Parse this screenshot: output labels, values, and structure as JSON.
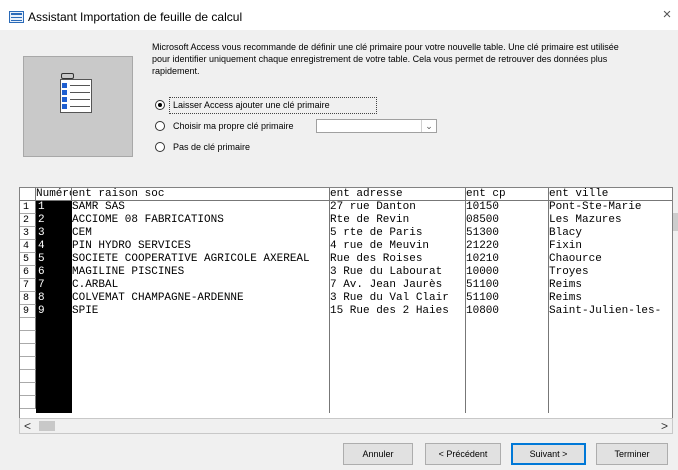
{
  "window": {
    "title": "Assistant Importation de feuille de calcul",
    "close": "×"
  },
  "description": "Microsoft Access vous recommande de définir une clé primaire pour votre nouvelle table. Une clé primaire est utilisée pour identifier uniquement chaque enregistrement de votre table.  Cela vous permet de retrouver des données plus rapidement.",
  "options": [
    {
      "label": "Laisser Access ajouter une clé primaire",
      "checked": true
    },
    {
      "label": "Choisir ma propre clé primaire",
      "checked": false
    },
    {
      "label": "Pas de clé primaire",
      "checked": false
    }
  ],
  "key_combo": {
    "value": "",
    "arrow": "⌄"
  },
  "grid": {
    "columns": [
      "Numéro",
      "ent raison soc",
      "ent adresse",
      "ent cp",
      "ent ville"
    ],
    "rows": [
      [
        "1",
        "1",
        "SAMR SAS",
        "27 rue Danton",
        "10150",
        "Pont-Ste-Marie"
      ],
      [
        "2",
        "2",
        "ACCIOME 08 FABRICATIONS",
        "Rte de Revin",
        "08500",
        "Les Mazures"
      ],
      [
        "3",
        "3",
        "CEM",
        "5 rte de Paris",
        "51300",
        "Blacy"
      ],
      [
        "4",
        "4",
        "PIN HYDRO SERVICES",
        "4 rue de Meuvin",
        "21220",
        "Fixin"
      ],
      [
        "5",
        "5",
        "SOCIETE COOPERATIVE AGRICOLE AXEREAL",
        "Rue des Roises",
        "10210",
        "Chaource"
      ],
      [
        "6",
        "6",
        "MAGILINE PISCINES",
        " 3 Rue du Labourat",
        "10000",
        "Troyes"
      ],
      [
        "7",
        "7",
        "C.ARBAL",
        "7 Av. Jean Jaurès",
        "51100",
        "Reims"
      ],
      [
        "8",
        "8",
        "COLVEMAT CHAMPAGNE-ARDENNE",
        "3 Rue du Val Clair",
        "51100",
        "Reims"
      ],
      [
        "9",
        "9",
        "SPIE",
        "15 Rue des 2 Haies",
        "10800",
        "Saint-Julien-les-"
      ]
    ]
  },
  "scroll": {
    "left": "<",
    "right": ">"
  },
  "buttons": {
    "cancel": "Annuler",
    "previous": "< Précédent",
    "next": "Suivant >",
    "finish": "Terminer"
  }
}
